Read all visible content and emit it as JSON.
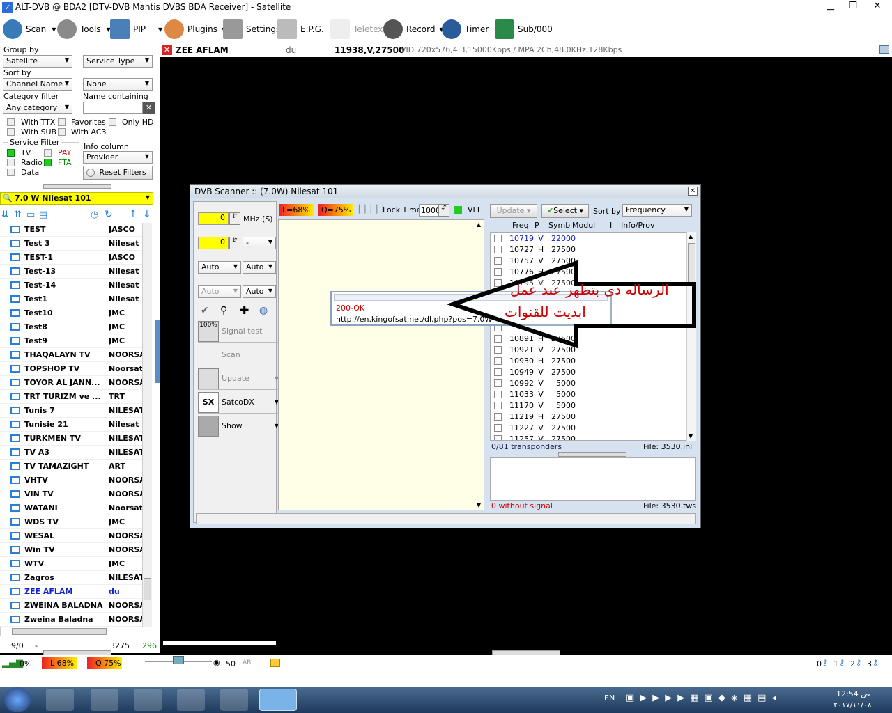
{
  "window": {
    "title": "ALT-DVB @ BDA2 [DTV-DVB Mantis DVBS BDA Receiver] - Satellite"
  },
  "toolbar": {
    "scan": "Scan",
    "tools": "Tools",
    "pip": "PIP",
    "plugins": "Plugins",
    "settings": "Settings",
    "epg": "E.P.G.",
    "teletext": "Teletext",
    "record": "Record",
    "timer": "Timer",
    "sub": "Sub/000"
  },
  "info": {
    "channel": "ZEE AFLAM",
    "provider": "du",
    "freq": "11938,V,27500",
    "details": "VID 720x576,4:3,15000Kbps / MPA 2Ch,48.0KHz,128Kbps"
  },
  "filters": {
    "group_by_label": "Group by",
    "group_by": "Satellite",
    "group_by2": "Service Type",
    "sort_by_label": "Sort by",
    "sort_by": "Channel Name",
    "sort_by2": "None",
    "category_label": "Category filter",
    "category": "Any category",
    "name_label": "Name containing",
    "with_ttx": "With TTX",
    "favorites": "Favorites",
    "only_hd": "Only HD",
    "with_sub": "With SUB",
    "with_ac3": "With AC3",
    "service_filter": "Service Filter",
    "tv": "TV",
    "pay": "PAY",
    "radio": "Radio",
    "fta": "FTA",
    "data": "Data",
    "info_column_label": "Info column",
    "info_column": "Provider",
    "reset": "Reset Filters"
  },
  "satellite": "7.0 W Nilesat 101",
  "channels": [
    {
      "name": "TEST",
      "prov": "JASCO"
    },
    {
      "name": "Test 3",
      "prov": "Nilesat"
    },
    {
      "name": "TEST-1",
      "prov": "JASCO"
    },
    {
      "name": "Test-13",
      "prov": "Nilesat"
    },
    {
      "name": "Test-14",
      "prov": "Nilesat"
    },
    {
      "name": "Test1",
      "prov": "Nilesat L"
    },
    {
      "name": "Test10",
      "prov": "JMC"
    },
    {
      "name": "Test8",
      "prov": "JMC"
    },
    {
      "name": "Test9",
      "prov": "JMC"
    },
    {
      "name": "THAQALAYN TV",
      "prov": "NOORSA"
    },
    {
      "name": "TOPSHOP TV",
      "prov": "Noorsat"
    },
    {
      "name": "TOYOR AL JANN...",
      "prov": "NOORSA"
    },
    {
      "name": "TRT TURIZM ve ...",
      "prov": "TRT"
    },
    {
      "name": "Tunis 7",
      "prov": "NILESAT"
    },
    {
      "name": "Tunisie 21",
      "prov": "Nilesat"
    },
    {
      "name": "TURKMEN TV",
      "prov": "NILESAT"
    },
    {
      "name": "TV A3",
      "prov": "NILESAT"
    },
    {
      "name": "TV TAMAZIGHT",
      "prov": "ART"
    },
    {
      "name": "VHTV",
      "prov": "NOORSA"
    },
    {
      "name": "VIN TV",
      "prov": "NOORSA"
    },
    {
      "name": "WATANI",
      "prov": "Noorsat"
    },
    {
      "name": "WDS TV",
      "prov": "JMC"
    },
    {
      "name": "WESAL",
      "prov": "NOORSA"
    },
    {
      "name": "Win TV",
      "prov": "NOORSA"
    },
    {
      "name": "WTV",
      "prov": "JMC"
    },
    {
      "name": "Zagros",
      "prov": "NILESAT"
    },
    {
      "name": "ZEE AFLAM",
      "prov": "du"
    },
    {
      "name": "ZWEINA BALADNA",
      "prov": "NOORSA"
    },
    {
      "name": "Zweina Baladna",
      "prov": "NOORSA"
    }
  ],
  "left_status": {
    "a": "9/0",
    "b": "-",
    "c": "3275",
    "d": "296"
  },
  "bottom": {
    "signal": "0%",
    "level": "L 68%",
    "quality": "Q 75%",
    "volume": "50",
    "ab": "AB",
    "keys": [
      "0",
      "1",
      "2",
      "3"
    ]
  },
  "scanner": {
    "title": "DVB Scanner :: (7.0W) Nilesat 101",
    "mhz_value": "0",
    "mhz_label": "MHz (S)",
    "sym_value": "0",
    "sym_select": "-",
    "auto1": "Auto",
    "auto2": "Auto",
    "auto3": "Auto",
    "auto4": "Auto",
    "level": "L=68%",
    "quality": "Q=75%",
    "lock_label": "Lock Time",
    "lock_value": "1000",
    "vlt": "VLT",
    "signal_test": "Signal test",
    "scan": "Scan",
    "update": "Update",
    "satcodx": "SatcoDX",
    "show": "Show",
    "update_btn": "Update",
    "select_btn": "Select",
    "sort_label": "Sort by",
    "sort_value": "Frequency",
    "cols": {
      "freq": "Freq",
      "p": "P",
      "symb": "Symb",
      "modul": "Modul",
      "i": "I",
      "info": "Info/Prov"
    },
    "transponders": [
      {
        "f": "10719",
        "p": "V",
        "s": "22000",
        "hl": true
      },
      {
        "f": "10727",
        "p": "H",
        "s": "27500"
      },
      {
        "f": "10757",
        "p": "V",
        "s": "27500"
      },
      {
        "f": "10776",
        "p": "H",
        "s": "27500"
      },
      {
        "f": "10795",
        "p": "V",
        "s": "27500"
      },
      {
        "f": "",
        "p": "",
        "s": ""
      },
      {
        "f": "",
        "p": "",
        "s": ""
      },
      {
        "f": "",
        "p": "",
        "s": ""
      },
      {
        "f": "",
        "p": "",
        "s": ""
      },
      {
        "f": "10891",
        "p": "H",
        "s": "27500"
      },
      {
        "f": "10921",
        "p": "V",
        "s": "27500"
      },
      {
        "f": "10930",
        "p": "H",
        "s": "27500"
      },
      {
        "f": "10949",
        "p": "V",
        "s": "27500"
      },
      {
        "f": "10992",
        "p": "V",
        "s": "5000"
      },
      {
        "f": "11033",
        "p": "V",
        "s": "5000"
      },
      {
        "f": "11170",
        "p": "V",
        "s": "5000"
      },
      {
        "f": "11219",
        "p": "H",
        "s": "27500"
      },
      {
        "f": "11227",
        "p": "V",
        "s": "27500"
      },
      {
        "f": "11257",
        "p": "V",
        "s": "27500"
      }
    ],
    "count": "0/81 transponders",
    "file1": "File: 3530.ini",
    "without": "0 without signal",
    "file2": "File: 3530.tws",
    "popup_status": "200-OK",
    "popup_url": "http://en.kingofsat.net/dl.php?pos=7.0W"
  },
  "annotation": {
    "line1": "الرساله دى بتظهر عند عمل",
    "line2": "ابديت للقنوات"
  },
  "tray": {
    "lang": "EN",
    "time": "12:54 ص",
    "date": "٢٠١٧/١١/٠٨"
  }
}
